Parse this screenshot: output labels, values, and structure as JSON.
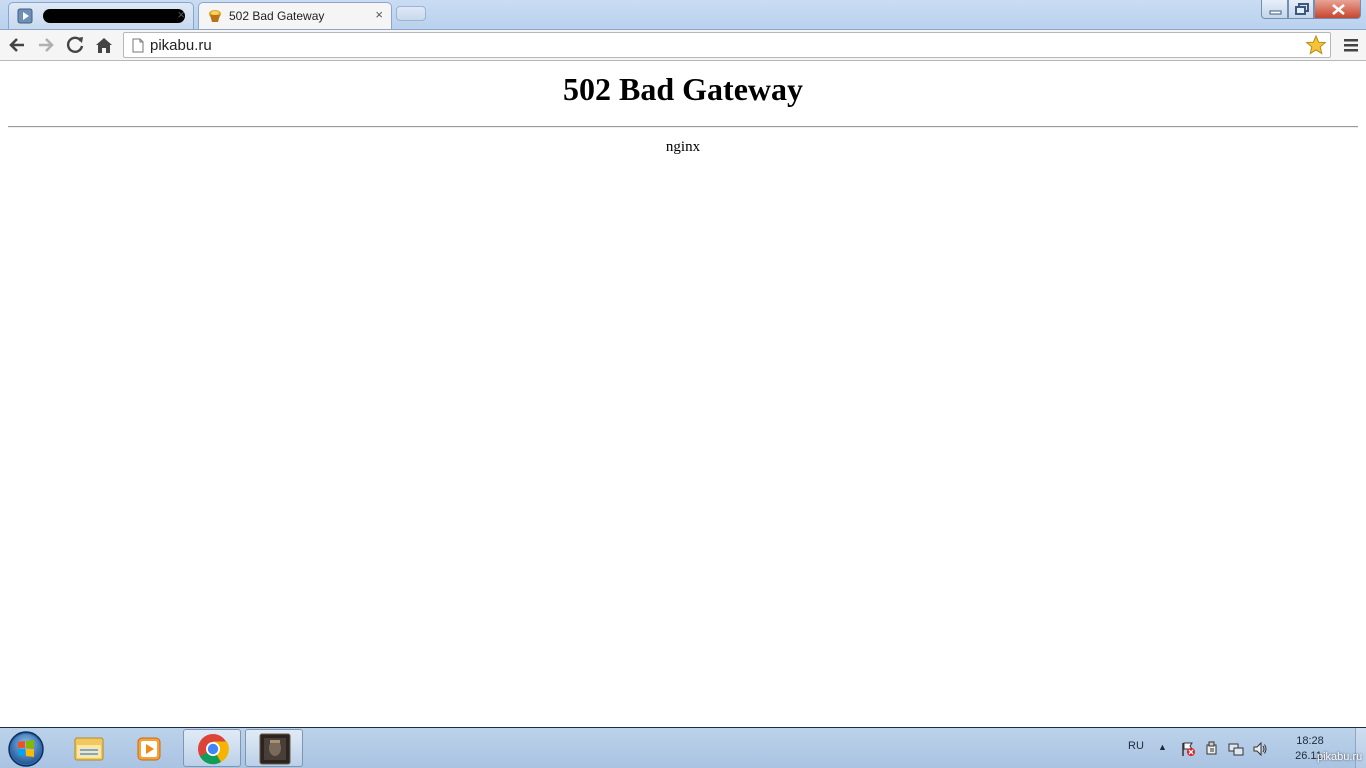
{
  "browser": {
    "tabs": [
      {
        "label": "",
        "close": "×",
        "favicon": "media-player-icon",
        "redacted": true
      },
      {
        "label": "502 Bad Gateway",
        "close": "×",
        "favicon": "pikabu-favicon-icon",
        "active": true
      }
    ],
    "address_bar": {
      "url": "pikabu.ru"
    },
    "toolbar_icons": [
      "back-arrow-icon",
      "forward-arrow-icon",
      "reload-icon",
      "home-icon",
      "page-icon",
      "bookmark-star-icon",
      "menu-icon"
    ]
  },
  "page": {
    "heading": "502 Bad Gateway",
    "server": "nginx"
  },
  "taskbar": {
    "pinned": [
      "windows-start-icon",
      "file-explorer-icon",
      "media-player-icon",
      "chrome-icon",
      "game-app-icon"
    ],
    "language": "RU",
    "tray_arrow": "▲",
    "clock_time": "18:28",
    "clock_date": "26.11.",
    "watermark": "pikabu.ru"
  }
}
